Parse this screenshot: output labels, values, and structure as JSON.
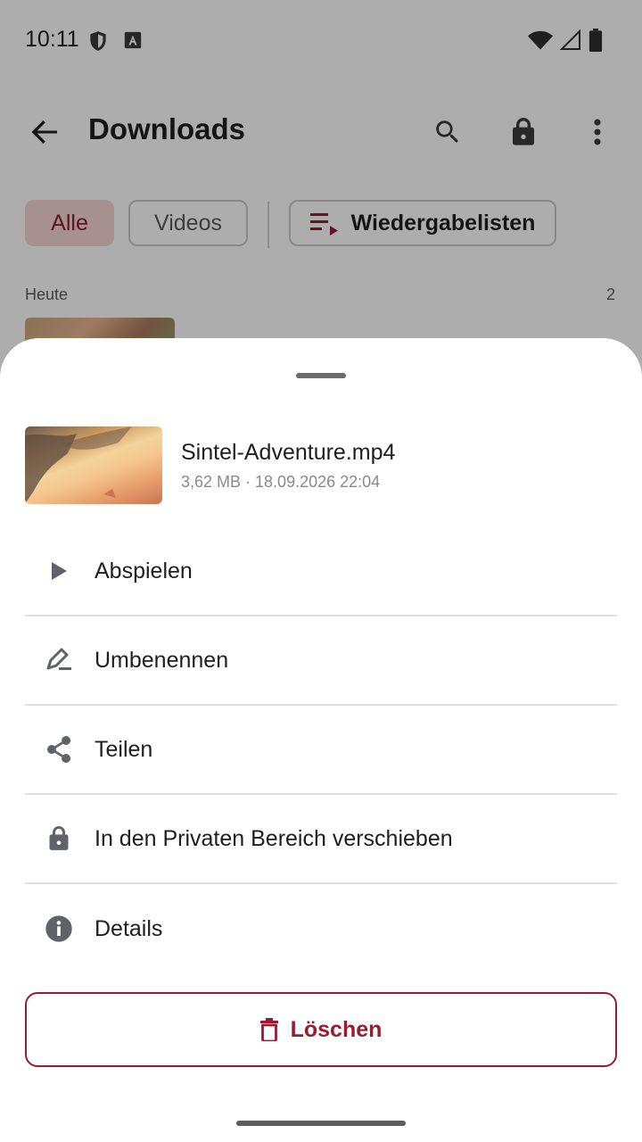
{
  "statusbar": {
    "time": "10:11"
  },
  "toolbar": {
    "title": "Downloads"
  },
  "filters": {
    "all_label": "Alle",
    "videos_label": "Videos",
    "playlists_label": "Wiedergabelisten"
  },
  "section": {
    "label": "Heute",
    "count": "2"
  },
  "sheet": {
    "file_name": "Sintel-Adventure.mp4",
    "file_meta": "3,62 MB · 18.09.2026 22:04",
    "items": [
      {
        "label": "Abspielen",
        "icon": "play-icon"
      },
      {
        "label": "Umbenennen",
        "icon": "rename-icon"
      },
      {
        "label": "Teilen",
        "icon": "share-icon"
      },
      {
        "label": "In den Privaten Bereich verschieben",
        "icon": "lock-icon"
      },
      {
        "label": "Details",
        "icon": "info-icon"
      }
    ],
    "delete_label": "Löschen"
  },
  "colors": {
    "accent": "#9b1c2f",
    "chip_selected_bg": "#f6d6d3",
    "icon_gray": "#5f6368"
  }
}
